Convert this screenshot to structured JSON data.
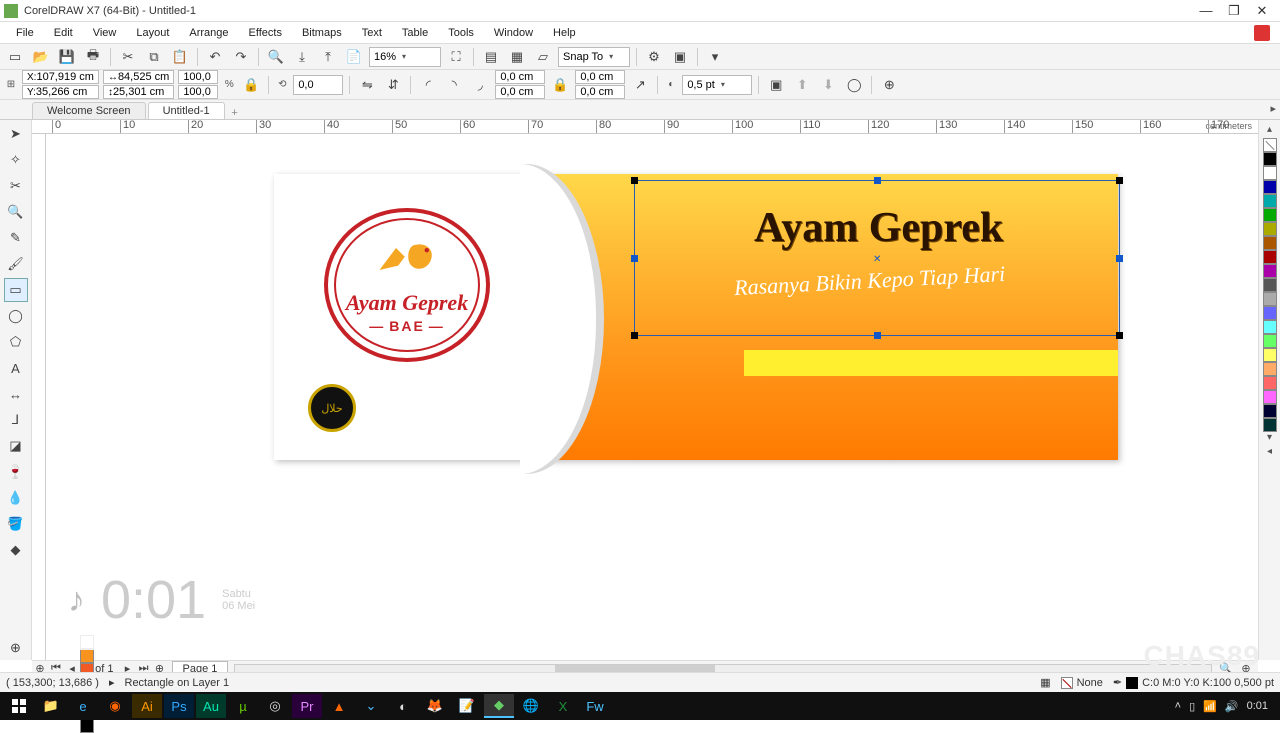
{
  "title": "CorelDRAW X7 (64-Bit) - Untitled-1",
  "menu": [
    "File",
    "Edit",
    "View",
    "Layout",
    "Arrange",
    "Effects",
    "Bitmaps",
    "Text",
    "Table",
    "Tools",
    "Window",
    "Help"
  ],
  "toolbar": {
    "zoom": "16%",
    "snap": "Snap To"
  },
  "prop": {
    "x": "107,919 cm",
    "y": "35,266 cm",
    "w": "84,525 cm",
    "h": "25,301 cm",
    "sx": "100,0",
    "sy": "100,0",
    "pct": "%",
    "rot": "0,0",
    "corner1": "0,0 cm",
    "corner2": "0,0 cm",
    "corner3": "0,0 cm",
    "corner4": "0,0 cm",
    "outline": "0,5 pt"
  },
  "tabs": {
    "t1": "Welcome Screen",
    "t2": "Untitled-1"
  },
  "ruler_unit": "centimeters",
  "art": {
    "logo_line1": "Ayam Geprek",
    "logo_line2": "BAE",
    "halal": "حلال",
    "headline": "Ayam Geprek",
    "subhead": "Rasanya Bikin Kepo Tiap Hari"
  },
  "page": {
    "counter": "1 of 1",
    "tab": "Page 1"
  },
  "status": {
    "coords": "( 153,300; 13,686 )",
    "object": "Rectangle on Layer 1",
    "fill": "None",
    "outline": "C:0 M:0 Y:0 K:100  0,500 pt"
  },
  "overlay": {
    "time": "0:01",
    "day": "Sabtu",
    "date": "06 Mei"
  },
  "tray": {
    "time": "0:01"
  },
  "watermark": "CHAS89",
  "palette_colors": [
    "#000",
    "#fff",
    "#00a",
    "#0aa",
    "#0a0",
    "#aa0",
    "#a50",
    "#a00",
    "#a0a",
    "#555",
    "#aaa",
    "#66f",
    "#6ff",
    "#6f6",
    "#ff6",
    "#fa6",
    "#f66",
    "#f6f",
    "#003",
    "#033"
  ],
  "doc_palette": [
    "#fff",
    "#f7931e",
    "#f15a24",
    "#fbb03b",
    "#f7e017",
    "#ed1c24",
    "#000"
  ]
}
